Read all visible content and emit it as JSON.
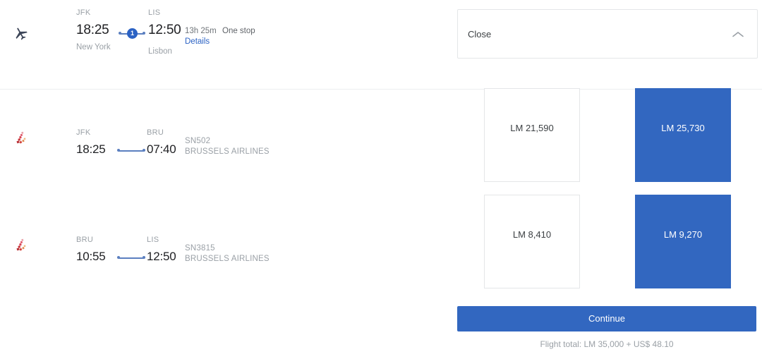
{
  "itinerary": {
    "icon": "airplane-icon",
    "departure": {
      "code": "JFK",
      "time": "18:25",
      "city": "New York"
    },
    "arrival": {
      "code": "LIS",
      "time": "12:50",
      "city": "Lisbon"
    },
    "stops_count": "1",
    "duration": "13h 25m",
    "stops_label": "One stop",
    "details_label": "Details"
  },
  "legs": [
    {
      "icon": "brussels-airlines-logo",
      "departure": {
        "code": "JFK",
        "time": "18:25"
      },
      "arrival": {
        "code": "BRU",
        "time": "07:40"
      },
      "flight_number": "SN502",
      "carrier": "BRUSSELS AIRLINES"
    },
    {
      "icon": "brussels-airlines-logo",
      "departure": {
        "code": "BRU",
        "time": "10:55"
      },
      "arrival": {
        "code": "LIS",
        "time": "12:50"
      },
      "flight_number": "SN3815",
      "carrier": "BRUSSELS AIRLINES"
    }
  ],
  "panel": {
    "close_label": "Close",
    "chevron_icon": "chevron-up-icon"
  },
  "fares": {
    "rows": [
      {
        "cards": [
          {
            "price": "LM 21,590",
            "selected": false
          },
          {
            "price": "LM 25,730",
            "selected": true
          }
        ]
      },
      {
        "cards": [
          {
            "price": "LM 8,410",
            "selected": false
          },
          {
            "price": "LM 9,270",
            "selected": true
          }
        ]
      }
    ]
  },
  "footer": {
    "continue_label": "Continue",
    "flight_total": "Flight total: LM 35,000 + US$ 48.10"
  },
  "colors": {
    "accent_blue": "#3267c0",
    "link_blue": "#2b62c4",
    "stop_bubble": "#2b62c4",
    "connector": "#5b7fc0",
    "muted_text": "#9aa0a6",
    "divider": "#eceef0"
  }
}
